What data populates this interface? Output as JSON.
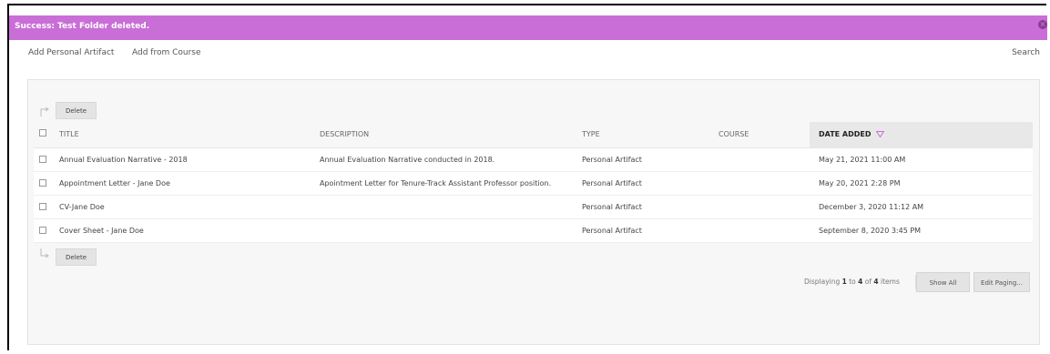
{
  "banner": {
    "message": "Success: Test Folder deleted.",
    "close_icon": "close-circle-icon"
  },
  "actionbar": {
    "add_personal_artifact": "Add Personal Artifact",
    "add_from_course": "Add from Course",
    "search": "Search"
  },
  "top_actions": {
    "delete_label": "Delete"
  },
  "bottom_actions": {
    "delete_label": "Delete"
  },
  "table": {
    "headers": {
      "title": "TITLE",
      "description": "DESCRIPTION",
      "type": "TYPE",
      "course": "COURSE",
      "date_added": "DATE ADDED"
    },
    "rows": [
      {
        "title": "Annual Evaluation Narrative - 2018",
        "description": "Annual Evaluation Narrative conducted in 2018.",
        "type": "Personal Artifact",
        "course": "",
        "date": "May 21, 2021 11:00 AM"
      },
      {
        "title": "Appointment Letter - Jane Doe",
        "description": "Apointment Letter for Tenure-Track Assistant Professor position.",
        "type": "Personal Artifact",
        "course": "",
        "date": "May 20, 2021 2:28 PM"
      },
      {
        "title": "CV-Jane Doe",
        "description": "",
        "type": "Personal Artifact",
        "course": "",
        "date": "December 3, 2020 11:12 AM"
      },
      {
        "title": "Cover Sheet - Jane Doe",
        "description": "",
        "type": "Personal Artifact",
        "course": "",
        "date": "September 8, 2020 3:45 PM"
      }
    ]
  },
  "paging": {
    "prefix": "Displaying ",
    "from": "1",
    "to_word": " to ",
    "to": "4",
    "of_word": " of ",
    "total": "4",
    "suffix": " items",
    "show_all": "Show All",
    "edit_paging": "Edit Paging..."
  },
  "colors": {
    "banner": "#c86ed6",
    "sort_arrow": "#c86ed6"
  }
}
